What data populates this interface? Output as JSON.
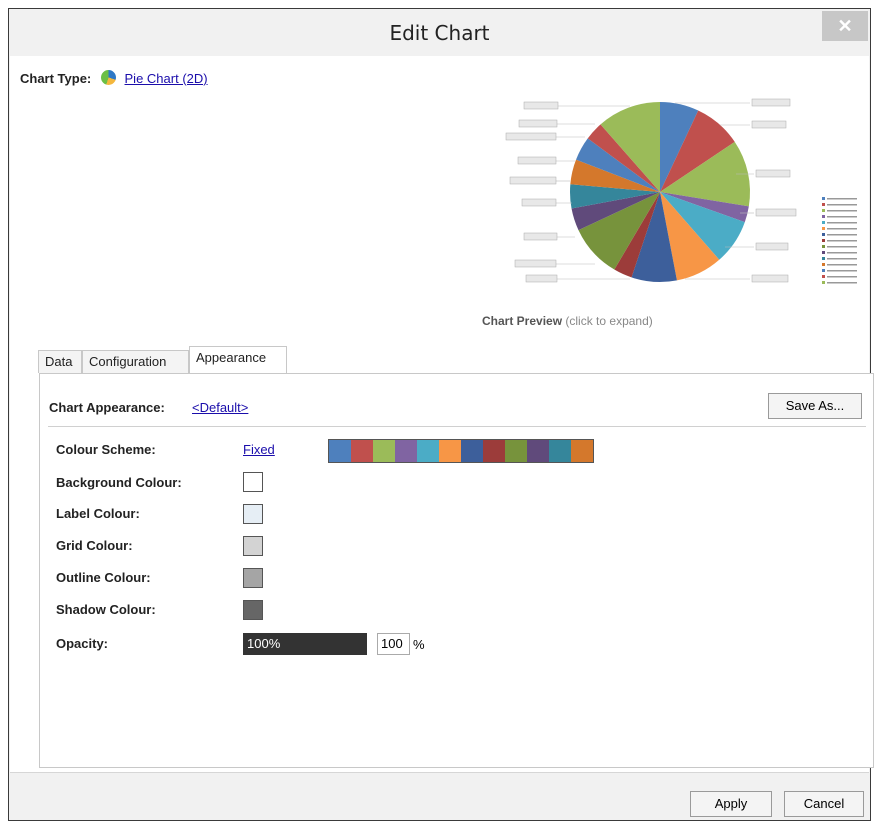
{
  "window": {
    "title": "Edit Chart",
    "close_glyph": "✕"
  },
  "chart_type": {
    "label": "Chart Type:",
    "value": "Pie Chart (2D)",
    "icon": "pie-chart-icon"
  },
  "preview": {
    "caption": "Chart Preview",
    "hint": "(click to expand)",
    "slices": [
      {
        "value": 7.3,
        "color": "#4e80bd"
      },
      {
        "value": 9.0,
        "color": "#c0504d"
      },
      {
        "value": 12.5,
        "color": "#9bbb59"
      },
      {
        "value": 3.0,
        "color": "#8064a2"
      },
      {
        "value": 8.5,
        "color": "#4bacc6"
      },
      {
        "value": 8.8,
        "color": "#f79646"
      },
      {
        "value": 8.5,
        "color": "#3d5f9b"
      },
      {
        "value": 3.5,
        "color": "#9c3c3a"
      },
      {
        "value": 10.0,
        "color": "#77933c"
      },
      {
        "value": 4.2,
        "color": "#604a7b"
      },
      {
        "value": 4.5,
        "color": "#35869b"
      },
      {
        "value": 4.7,
        "color": "#d4782c"
      },
      {
        "value": 4.5,
        "color": "#4e80bd"
      },
      {
        "value": 3.5,
        "color": "#c0504d"
      },
      {
        "value": 12.0,
        "color": "#9bbb59"
      }
    ]
  },
  "tabs": [
    "Data",
    "Configuration",
    "Appearance"
  ],
  "appearance": {
    "label": "Chart Appearance:",
    "value": "<Default>",
    "save_as": "Save As...",
    "colour_scheme_label": "Colour Scheme:",
    "colour_scheme_value": "Fixed",
    "scheme_colors": [
      "#4e80bd",
      "#c0504d",
      "#9bbb59",
      "#8064a2",
      "#4bacc6",
      "#f79646",
      "#3d5f9b",
      "#9c3c3a",
      "#77933c",
      "#604a7b",
      "#35869b",
      "#d4782c"
    ],
    "background_colour_label": "Background Colour:",
    "background_colour": "#ffffff",
    "label_colour_label": "Label Colour:",
    "label_colour": "#e6eef5",
    "grid_colour_label": "Grid Colour:",
    "grid_colour": "#d3d3d3",
    "outline_colour_label": "Outline Colour:",
    "outline_colour": "#a5a5a5",
    "shadow_colour_label": "Shadow Colour:",
    "shadow_colour": "#666666",
    "opacity_label": "Opacity:",
    "opacity_display": "100%",
    "opacity_value": "100",
    "opacity_unit": "%"
  },
  "footer": {
    "apply": "Apply",
    "cancel": "Cancel"
  }
}
